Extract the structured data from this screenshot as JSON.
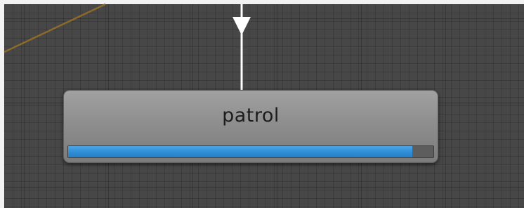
{
  "node": {
    "title": "patrol",
    "progress": 0.942
  },
  "colors": {
    "background": "#474747",
    "node_fill": "#8e8e8e",
    "progress_fill": "#2d8bd5",
    "progress_track": "#5d5d5d",
    "incoming_connection": "#ffffff",
    "side_connection": "#8b6a2b"
  },
  "icons": {
    "incoming_arrow": "arrow-down-icon"
  }
}
